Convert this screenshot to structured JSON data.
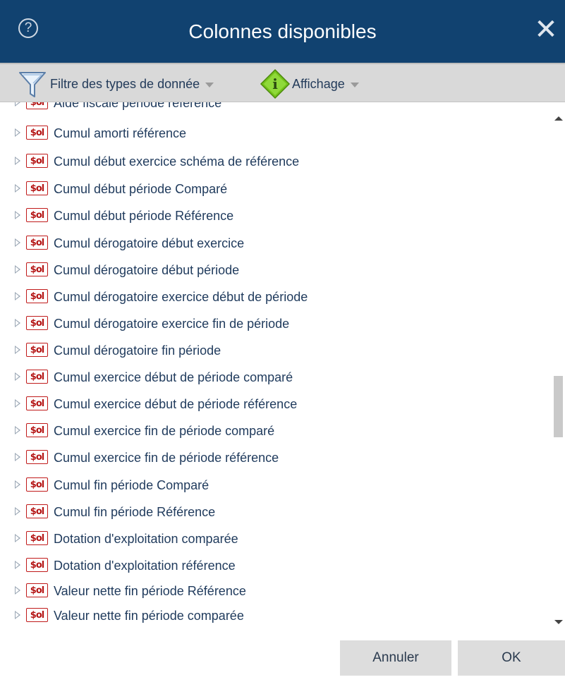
{
  "dialog": {
    "title": "Colonnes disponibles",
    "help_icon_glyph": "?",
    "close_icon_glyph": "✕",
    "accent_color": "#114270"
  },
  "toolbar": {
    "filter_label": "Filtre des types de donnée",
    "filter_icon": "funnel-icon",
    "display_label": "Affichage",
    "display_icon": "info-diamond-icon"
  },
  "list": {
    "item_icon_text": "$ol",
    "partial_top_item": "Aide fiscale période référence",
    "items": [
      "Cumul amorti référence",
      "Cumul début exercice schéma de référence",
      "Cumul début période Comparé",
      "Cumul début période Référence",
      "Cumul dérogatoire début exercice",
      "Cumul dérogatoire début période",
      "Cumul dérogatoire exercice début de période",
      "Cumul dérogatoire exercice fin de période",
      "Cumul dérogatoire fin période",
      "Cumul exercice début de période comparé",
      "Cumul exercice début de période référence",
      "Cumul exercice fin de période comparé",
      "Cumul exercice fin de période référence",
      "Cumul fin période Comparé",
      "Cumul fin période Référence",
      "Dotation d'exploitation comparée",
      "Dotation d'exploitation référence",
      "Valeur nette fin période Référence",
      "Valeur nette fin période comparée"
    ]
  },
  "footer": {
    "cancel_label": "Annuler",
    "ok_label": "OK"
  }
}
